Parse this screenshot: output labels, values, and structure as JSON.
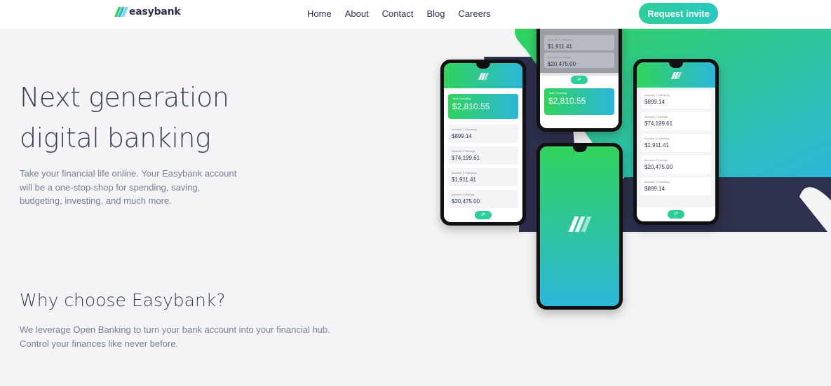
{
  "header": {
    "logo_text": "easybank",
    "nav": [
      "Home",
      "About",
      "Contact",
      "Blog",
      "Careers"
    ],
    "cta_label": "Request invite"
  },
  "hero": {
    "title_line1": "Next generation",
    "title_line2": "digital banking",
    "description": "Take your financial life online. Your Easybank account will be a one-stop-shop for spending, saving, budgeting, investing, and much more."
  },
  "why": {
    "title": "Why choose Easybank?",
    "description": "We leverage Open Banking to turn your bank account into your financial hub. Control your finances like never before."
  },
  "phones": {
    "left": {
      "total_label": "Total Checking",
      "total_amount": "$2,810.55",
      "accounts": [
        {
          "label": "Account 1 Checking",
          "amount": "$899.14"
        },
        {
          "label": "Account 2 Savings",
          "amount": "$74,199.61"
        },
        {
          "label": "Account 3 Checking",
          "amount": "$1,911.41"
        },
        {
          "label": "Account 4 Savings",
          "amount": "$20,475.00"
        }
      ]
    },
    "top_middle": {
      "accounts": [
        {
          "label": "Account 3 Checking",
          "amount": "$1,911.41"
        },
        {
          "label": "Account 4 Savings",
          "amount": "$20,475.00"
        }
      ],
      "total_label": "Total Checking",
      "total_amount": "$2,810.55"
    },
    "right": {
      "accounts": [
        {
          "label": "Account 1 Checking",
          "amount": "$899.14"
        },
        {
          "label": "Account 2 Savings",
          "amount": "$74,199.61"
        },
        {
          "label": "Account 3 Checking",
          "amount": "$1,911.41"
        },
        {
          "label": "Account 4 Savings",
          "amount": "$20,475.00"
        },
        {
          "label": "Account 5 Checking",
          "amount": "$899.14"
        }
      ]
    }
  },
  "colors": {
    "primary": "#2d314d",
    "lime_green": "#31d35c",
    "bright_cyan": "#2bb7da",
    "background": "#f3f4f6"
  }
}
